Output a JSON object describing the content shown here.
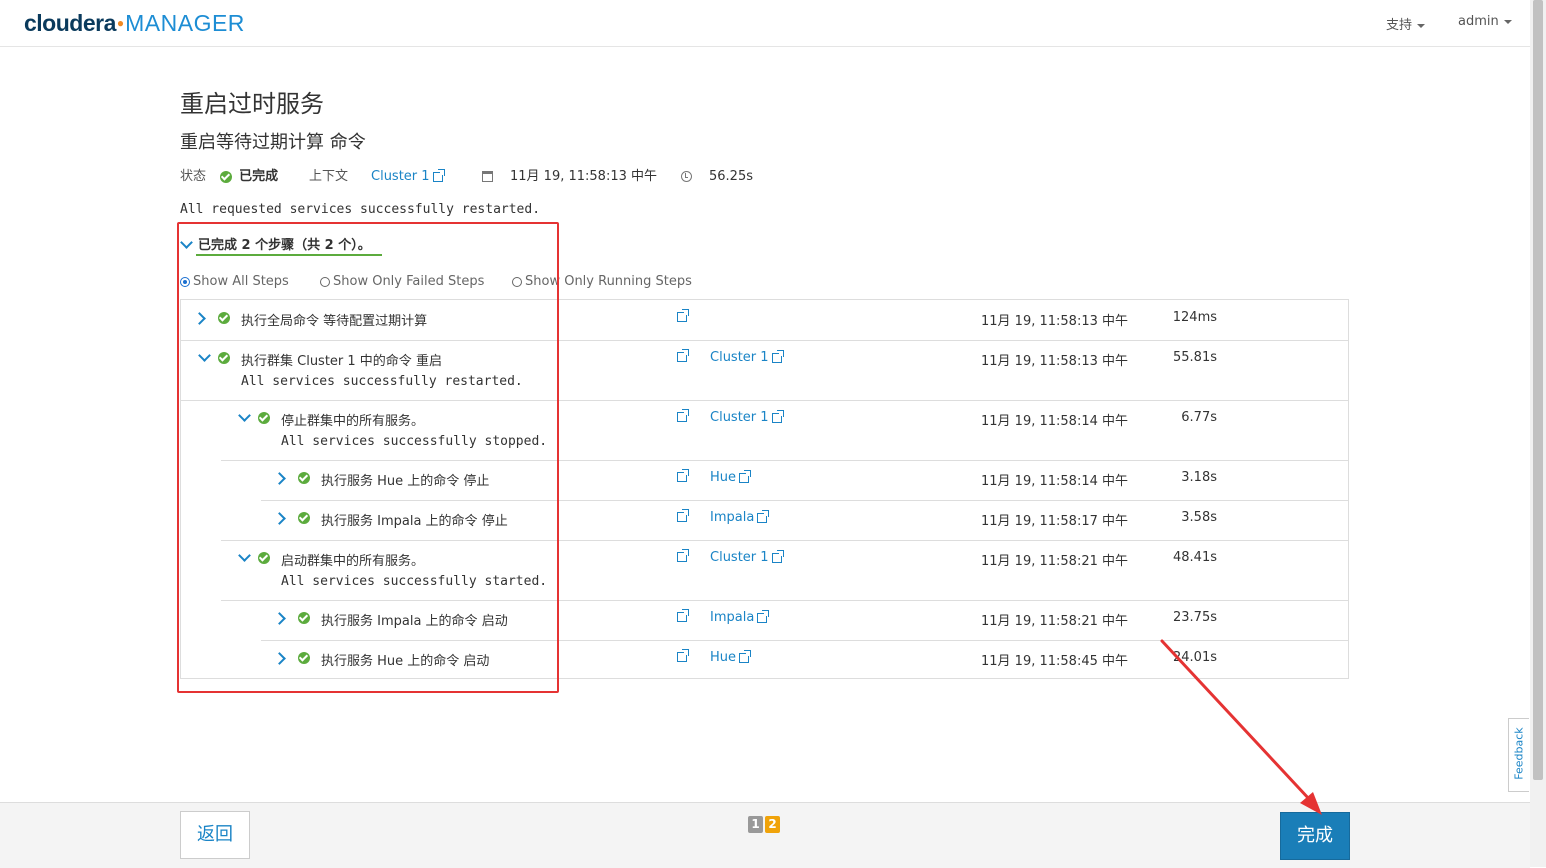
{
  "header": {
    "logo_brand": "cloudera",
    "logo_product": "MANAGER",
    "nav_support": "支持",
    "nav_user": "admin"
  },
  "page": {
    "title": "重启过时服务",
    "command_title": "重启等待过期计算 命令"
  },
  "status": {
    "status_label": "状态",
    "status_value": "已完成",
    "context_label": "上下文",
    "context_value": "Cluster 1",
    "start_time": "11月 19, 11:58:13 中午",
    "duration": "56.25s"
  },
  "result_message": "All requested services successfully restarted.",
  "summary": "已完成 2 个步骤（共 2 个）。",
  "filters": {
    "all": "Show All Steps",
    "failed": "Show Only Failed Steps",
    "running": "Show Only Running Steps",
    "selected": "all"
  },
  "steps": [
    {
      "name": "执行全局命令 等待配置过期计算",
      "message": "",
      "context": "",
      "time": "11月 19, 11:58:13 中午",
      "duration": "124ms",
      "expanded": false
    },
    {
      "name": "执行群集 Cluster 1 中的命令 重启",
      "message": "All services successfully restarted.",
      "context": "Cluster 1",
      "time": "11月 19, 11:58:13 中午",
      "duration": "55.81s",
      "expanded": true
    },
    {
      "name": "停止群集中的所有服务。",
      "message": "All services successfully stopped.",
      "context": "Cluster 1",
      "time": "11月 19, 11:58:14 中午",
      "duration": "6.77s",
      "expanded": true
    },
    {
      "name": "执行服务 Hue 上的命令 停止",
      "message": "",
      "context": "Hue",
      "time": "11月 19, 11:58:14 中午",
      "duration": "3.18s",
      "expanded": false
    },
    {
      "name": "执行服务 Impala 上的命令 停止",
      "message": "",
      "context": "Impala",
      "time": "11月 19, 11:58:17 中午",
      "duration": "3.58s",
      "expanded": false
    },
    {
      "name": "启动群集中的所有服务。",
      "message": "All services successfully started.",
      "context": "Cluster 1",
      "time": "11月 19, 11:58:21 中午",
      "duration": "48.41s",
      "expanded": true
    },
    {
      "name": "执行服务 Impala 上的命令 启动",
      "message": "",
      "context": "Impala",
      "time": "11月 19, 11:58:21 中午",
      "duration": "23.75s",
      "expanded": false
    },
    {
      "name": "执行服务 Hue 上的命令 启动",
      "message": "",
      "context": "Hue",
      "time": "11月 19, 11:58:45 中午",
      "duration": "24.01s",
      "expanded": false
    }
  ],
  "footer": {
    "back": "返回",
    "page1": "1",
    "page2": "2",
    "finish": "完成"
  },
  "feedback": "Feedback",
  "colors": {
    "accent": "#1a84c6",
    "success": "#5cab3d",
    "annotation": "#e53333",
    "primary_button": "#1a7eb8"
  }
}
